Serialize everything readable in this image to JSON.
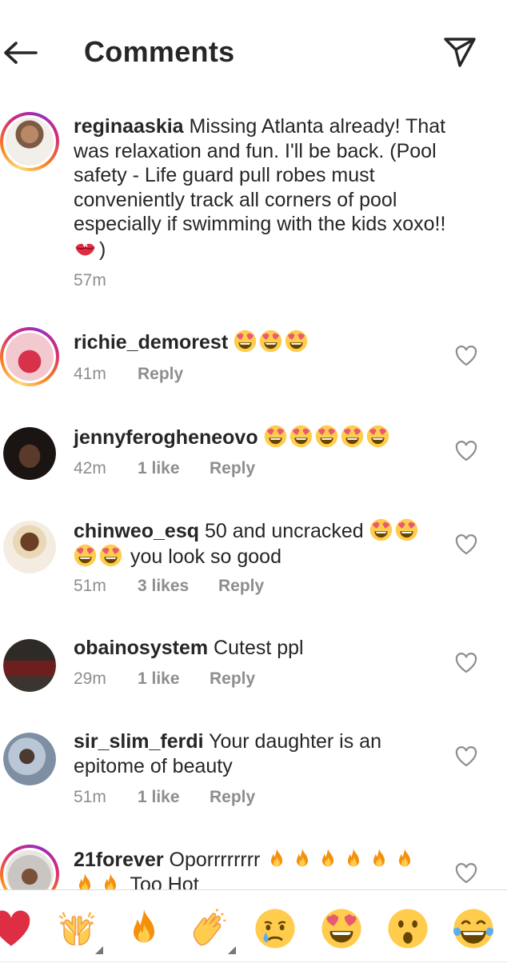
{
  "header": {
    "title": "Comments",
    "back_icon": "arrow-left-icon",
    "send_icon": "paper-plane-icon"
  },
  "comments": [
    {
      "username": "reginaaskia",
      "text_before": " Missing Atlanta already! That was relaxation and fun. I'll be back. (Pool safety - Life guard pull robes must conveniently track all corners of pool especially if swimming with the kids xoxo!!",
      "text_emoji": "kiss-mark-emoji",
      "text_after": ")",
      "time": "57m",
      "likes": "",
      "reply": "",
      "story_ring": true
    },
    {
      "username": "richie_demorest",
      "emoji": "heart-eyes-emoji",
      "emoji_count": 3,
      "time": "41m",
      "likes": "",
      "reply": "Reply",
      "story_ring": true
    },
    {
      "username": "jennyferogheneovo",
      "emoji": "heart-eyes-emoji",
      "emoji_count": 5,
      "time": "42m",
      "likes": "1 like",
      "reply": "Reply",
      "story_ring": false
    },
    {
      "username": "chinweo_esq",
      "text_before": " 50 and uncracked",
      "text_after": "you look so good",
      "time": "51m",
      "likes": "3 likes",
      "reply": "Reply",
      "story_ring": false
    },
    {
      "username": "obainosystem",
      "text": " Cutest ppl",
      "time": "29m",
      "likes": "1 like",
      "reply": "Reply",
      "story_ring": false
    },
    {
      "username": "sir_slim_ferdi",
      "text": " Your daughter is an epitome of beauty",
      "time": "51m",
      "likes": "1 like",
      "reply": "Reply",
      "story_ring": false
    },
    {
      "username": "21forever",
      "text_before": " Oporrrrrrrr",
      "text_after": "Too Hot",
      "story_ring": true
    }
  ],
  "emoji_bar": [
    "red-heart-emoji",
    "raising-hands-emoji",
    "fire-emoji",
    "clapping-hands-emoji",
    "crying-face-emoji",
    "heart-eyes-emoji",
    "surprised-face-emoji",
    "tears-of-joy-emoji"
  ],
  "colors": {
    "text": "#262626",
    "muted": "#8e8e8e",
    "divider": "#dbdbdb",
    "story_ring": [
      "#feda75",
      "#fa7e1e",
      "#d62976",
      "#962fbf"
    ]
  }
}
